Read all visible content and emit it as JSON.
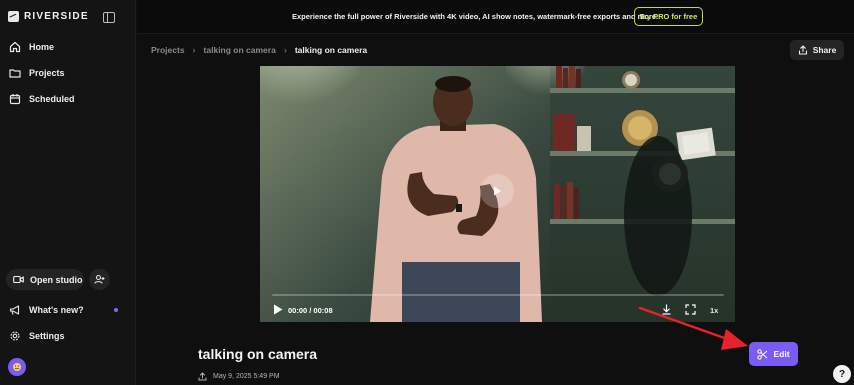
{
  "app": {
    "brand_name": "RIVERSIDE"
  },
  "sidebar": {
    "nav": [
      {
        "label": "Home",
        "icon": "home-icon"
      },
      {
        "label": "Projects",
        "icon": "folder-icon"
      },
      {
        "label": "Scheduled",
        "icon": "calendar-icon"
      }
    ],
    "open_studio_label": "Open studio",
    "whats_new_label": "What's new?",
    "settings_label": "Settings"
  },
  "topbar": {
    "promo_text": "Experience the full power of Riverside with 4K video, AI show notes, watermark-free exports and more.",
    "try_pro_label": "Try PRO for free"
  },
  "breadcrumb": {
    "items": [
      "Projects",
      "talking on camera"
    ],
    "current": "talking on camera"
  },
  "share_label": "Share",
  "player": {
    "time_label": "00:00 / 00:08",
    "progress": 0,
    "speed_label": "1x"
  },
  "project": {
    "title": "talking on camera",
    "date": "May 9, 2025 5:49 PM"
  },
  "edit_label": "Edit",
  "help_label": "?",
  "colors": {
    "accent": "#7b5cf2",
    "pro_green": "#cbe86b",
    "annotation_red": "#e8222b",
    "background": "#0f0f0f"
  }
}
